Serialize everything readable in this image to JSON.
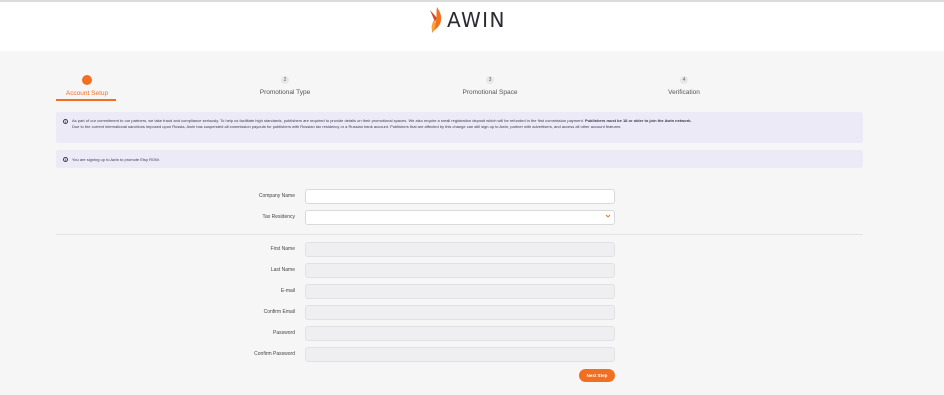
{
  "brand": {
    "name": "AWIN",
    "accent_color": "#f26f21"
  },
  "steps": [
    {
      "number": "1",
      "label": "Account Setup",
      "active": true
    },
    {
      "number": "2",
      "label": "Promotional Type",
      "active": false
    },
    {
      "number": "3",
      "label": "Promotional Space",
      "active": false
    },
    {
      "number": "4",
      "label": "Verification",
      "active": false
    }
  ],
  "notices": {
    "compliance_text": "As part of our commitment to our partners, we take fraud and compliance seriously. To help us facilitate high standards, publishers are required to provide details on their promotional spaces. We also require a small registration deposit which will be refunded in the first commission payment.",
    "age_text": "Publishers must be 18 or older to join the Awin network.",
    "sanctions_text": "Due to the current international sanctions imposed upon Russia, Awin has suspended all commission payouts for publishers with Russian tax residency or a Russian bank account. Publishers that are affected by this change can still sign up to Awin, partner with advertisers, and access all other account features.",
    "signup_text": "You are signing up to Awin to promote Etsy ROW.",
    "info_icon": "info-icon"
  },
  "form": {
    "company_name_label": "Company Name",
    "company_name_value": "",
    "tax_residency_label": "Tax Residency",
    "tax_residency_value": "",
    "first_name_label": "First Name",
    "last_name_label": "Last Name",
    "email_label": "E-mail",
    "confirm_email_label": "Confirm Email",
    "password_label": "Password",
    "confirm_password_label": "Confirm Password"
  },
  "actions": {
    "next_label": "Next Step"
  }
}
